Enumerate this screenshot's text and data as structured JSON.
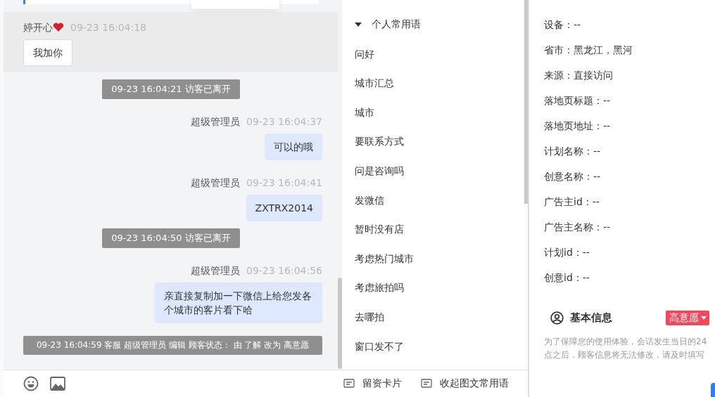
{
  "chat": {
    "messages": [
      {
        "kind": "visitor",
        "name": "婷开心",
        "time": "09-23 16:04:18",
        "text": "我加你"
      },
      {
        "kind": "system",
        "text": "09-23 16:04:21 访客已离开"
      },
      {
        "kind": "agent",
        "name": "超级管理员",
        "time": "09-23 16:04:37",
        "text": "可以的哦"
      },
      {
        "kind": "agent",
        "name": "超级管理员",
        "time": "09-23 16:04:41",
        "text": "ZXTRX2014"
      },
      {
        "kind": "system",
        "text": "09-23 16:04:50 访客已离开"
      },
      {
        "kind": "agent",
        "name": "超级管理员",
        "time": "09-23 16:04:56",
        "text": "亲直接复制加一下微信上给您发各个城市的客片看下哈"
      },
      {
        "kind": "notice",
        "text": "09-23 16:04:59 客服 超级管理员 编辑 顾客状态： 由 了解 改为 高意愿"
      }
    ]
  },
  "phrases": {
    "group": {
      "title": "个人常用语",
      "expanded": true
    },
    "items": [
      "问好",
      "城市汇总",
      "城市",
      "要联系方式",
      "问是咨询吗",
      "发微信",
      "暂时没有店",
      "考虑热门城市",
      "考虑旅拍吗",
      "去哪拍",
      "窗口发不了"
    ]
  },
  "toolbar": {
    "actions": [
      "留资卡片",
      "收起图文常用语"
    ]
  },
  "visitor_info": {
    "lines": [
      "设备：--",
      "省市：黑龙江，黑河",
      "来源：直接访问",
      "落地页标题：--",
      "落地页地址：--",
      "计划名称：--",
      "创意名称：--",
      "广告主id：--",
      "广告主名称：--",
      "计划id：--",
      "创意id：--"
    ]
  },
  "basic_info": {
    "title": "基本信息",
    "status": {
      "label": "高意愿",
      "color": "#f5475a"
    },
    "note": "为了保障您的使用体验，会话发生当日的24点之后，顾客信息将无法修改，请及时填写"
  }
}
